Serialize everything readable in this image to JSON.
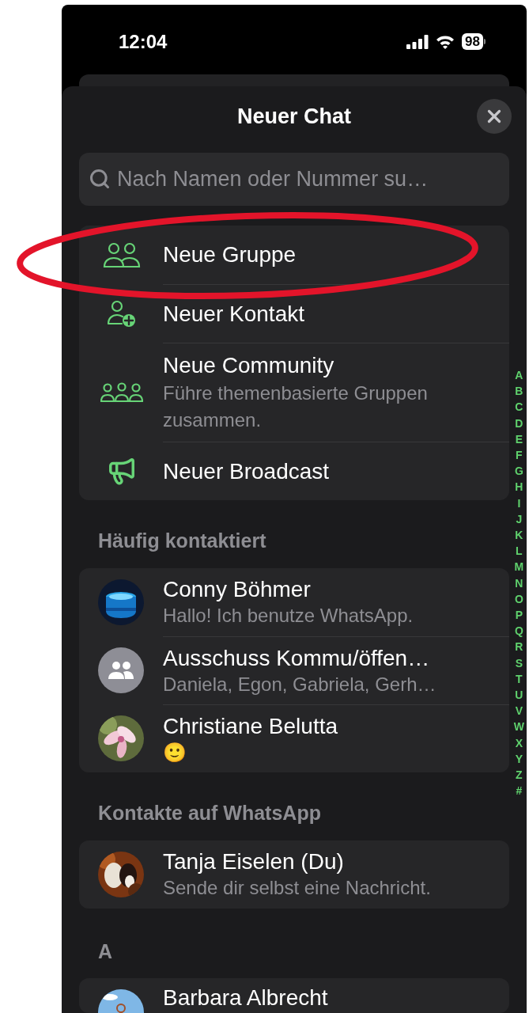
{
  "status_bar": {
    "time": "12:04",
    "battery": "98"
  },
  "sheet": {
    "title": "Neuer Chat"
  },
  "search": {
    "placeholder": "Nach Namen oder Nummer su…"
  },
  "actions": [
    {
      "kind": "group",
      "label": "Neue Gruppe"
    },
    {
      "kind": "contact",
      "label": "Neuer Kontakt"
    },
    {
      "kind": "community",
      "label": "Neue Community",
      "subtitle": "Führe themenbasierte Gruppen zusammen."
    },
    {
      "kind": "broadcast",
      "label": "Neuer Broadcast"
    }
  ],
  "sections": [
    {
      "title": "Häufig kontaktiert",
      "contacts": [
        {
          "kind": "picture",
          "name": "Conny Böhmer",
          "status": "Hallo! Ich benutze WhatsApp."
        },
        {
          "kind": "group",
          "name": "Ausschuss Kommu/öffen…",
          "status": "Daniela, Egon, Gabriela, Gerh…"
        },
        {
          "kind": "picture",
          "name": "Christiane Belutta",
          "status": "🙂"
        }
      ]
    },
    {
      "title": "Kontakte auf WhatsApp",
      "contacts": [
        {
          "kind": "picture",
          "name": "Tanja Eiselen (Du)",
          "status": "Sende dir selbst eine Nachricht."
        }
      ]
    },
    {
      "title": "A",
      "contacts": [
        {
          "kind": "picture",
          "name": "Barbara Albrecht"
        }
      ]
    }
  ],
  "index": [
    "A",
    "B",
    "C",
    "D",
    "E",
    "F",
    "G",
    "H",
    "I",
    "J",
    "K",
    "L",
    "M",
    "N",
    "O",
    "P",
    "Q",
    "R",
    "S",
    "T",
    "U",
    "V",
    "W",
    "X",
    "Y",
    "Z",
    "#"
  ]
}
